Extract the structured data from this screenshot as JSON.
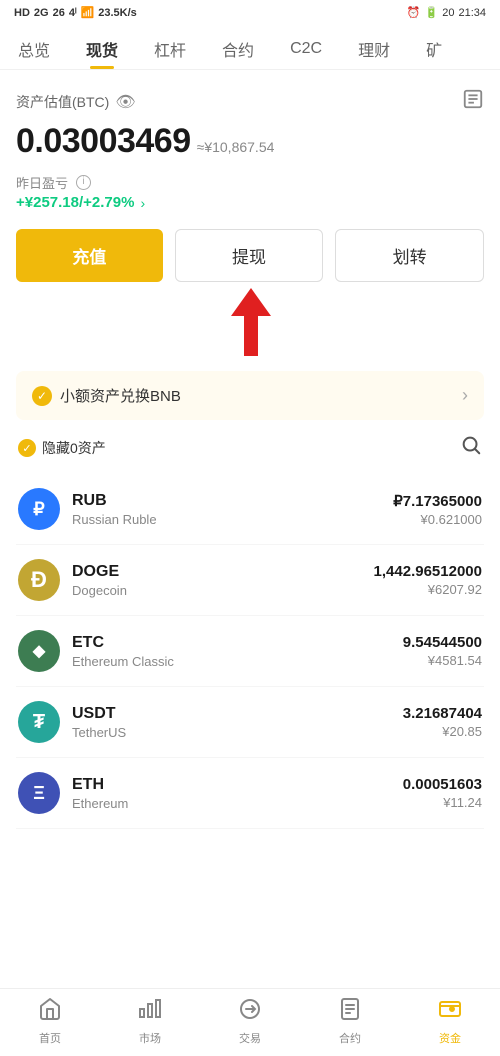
{
  "statusBar": {
    "leftItems": [
      "HD",
      "2G",
      "26",
      "46",
      "wifi",
      "23.5 K/s"
    ],
    "rightItems": [
      "alarm",
      "battery",
      "20",
      "21:34"
    ]
  },
  "navTabs": [
    {
      "id": "overview",
      "label": "总览",
      "active": false
    },
    {
      "id": "spot",
      "label": "现货",
      "active": true
    },
    {
      "id": "leverage",
      "label": "杠杆",
      "active": false
    },
    {
      "id": "contract",
      "label": "合约",
      "active": false
    },
    {
      "id": "c2c",
      "label": "C2C",
      "active": false
    },
    {
      "id": "finance",
      "label": "理财",
      "active": false
    },
    {
      "id": "mine",
      "label": "矿",
      "active": false
    }
  ],
  "assetSection": {
    "label": "资产估值(BTC)",
    "btcValue": "0.03003469",
    "cnyApprox": "≈¥10,867.54",
    "pnlLabel": "昨日盈亏",
    "pnlValue": "+¥257.18/+2.79%",
    "pnlArrow": ">"
  },
  "buttons": {
    "recharge": "充值",
    "withdraw": "提现",
    "transfer": "划转"
  },
  "bnbBanner": {
    "text": "小额资产兑换BNB",
    "arrow": ">"
  },
  "assetsListHeader": {
    "hideZeroLabel": "隐藏0资产"
  },
  "assets": [
    {
      "symbol": "RUB",
      "name": "Russian Ruble",
      "amount": "₽7.17365000",
      "cny": "¥0.621000",
      "iconBg": "#2979ff",
      "iconText": "₽",
      "iconFont": "20px"
    },
    {
      "symbol": "DOGE",
      "name": "Dogecoin",
      "amount": "1,442.96512000",
      "cny": "¥6207.92",
      "iconBg": "#c2a633",
      "iconText": "Ð",
      "iconFont": "20px"
    },
    {
      "symbol": "ETC",
      "name": "Ethereum Classic",
      "amount": "9.54544500",
      "cny": "¥4581.54",
      "iconBg": "#4caf50",
      "iconText": "◆",
      "iconFont": "16px"
    },
    {
      "symbol": "USDT",
      "name": "TetherUS",
      "amount": "3.21687404",
      "cny": "¥20.85",
      "iconBg": "#26a69a",
      "iconText": "₮",
      "iconFont": "20px"
    },
    {
      "symbol": "ETH",
      "name": "Ethereum",
      "amount": "0.00051603",
      "cny": "¥11.24",
      "iconBg": "#3f51b5",
      "iconText": "Ξ",
      "iconFont": "18px"
    }
  ],
  "bottomNav": [
    {
      "id": "home",
      "label": "首页",
      "icon": "⌂",
      "active": false
    },
    {
      "id": "market",
      "label": "市场",
      "icon": "📊",
      "active": false
    },
    {
      "id": "trade",
      "label": "交易",
      "icon": "🔄",
      "active": false
    },
    {
      "id": "contract",
      "label": "合约",
      "icon": "📄",
      "active": false
    },
    {
      "id": "assets",
      "label": "资金",
      "icon": "💰",
      "active": true
    }
  ]
}
